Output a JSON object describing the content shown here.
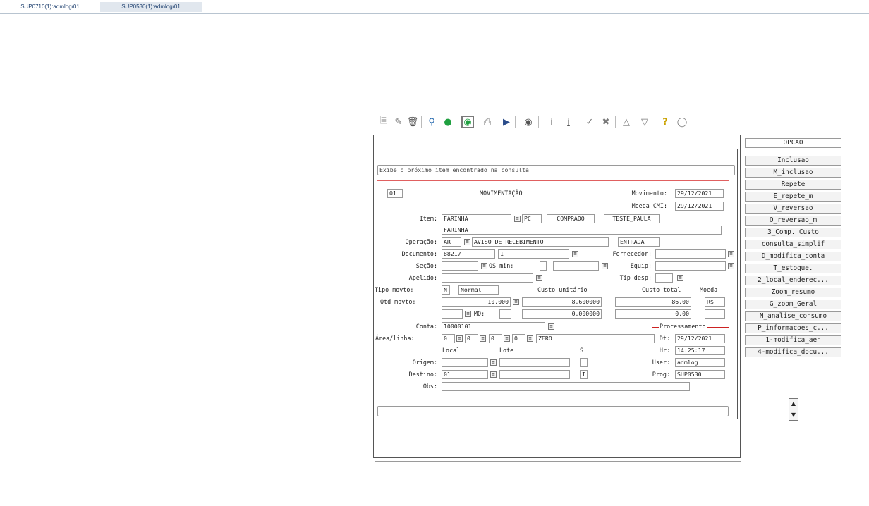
{
  "tabs": [
    "SUP0710(1):admlog/01",
    "SUP0530(1):admlog/01"
  ],
  "toolbar": {
    "icons": [
      "new-doc-icon",
      "edit-doc-icon",
      "trash-icon",
      "search-icon",
      "go-green-icon",
      "go-green-selected-icon",
      "print-icon",
      "export-icon",
      "binoculars-icon",
      "info-icon",
      "underline-info-icon",
      "check-icon",
      "scissors-icon",
      "triangle-up-icon",
      "triangle-down-icon",
      "help-icon",
      "chat-icon"
    ]
  },
  "status_message": "Exibe o próximo item encontrado na consulta",
  "form": {
    "code": "01",
    "header_title": "MOVIMENTAÇÃO",
    "movimento_label": "Movimento:",
    "movimento_value": "29/12/2021",
    "moeda_cmi_label": "Moeda CMI:",
    "moeda_cmi_value": "29/12/2021",
    "item_label": "Item:",
    "item_code": "FARINHA",
    "item_unit": "PC",
    "item_type": "COMPRADO",
    "item_user": "TESTE_PAULA",
    "item_desc": "FARINHA",
    "operacao_label": "Operação:",
    "operacao_code": "AR",
    "operacao_desc": "AVISO DE RECEBIMENTO",
    "operacao_type": "ENTRADA",
    "documento_label": "Documento:",
    "documento_value": "88217",
    "documento_seq": "1",
    "fornecedor_label": "Fornecedor:",
    "secao_label": "Seção:",
    "os_min_label": "OS min:",
    "equip_label": "Equip:",
    "apelido_label": "Apelido:",
    "tip_desp_label": "Tip desp:",
    "tipo_movto_label": "Tipo movto:",
    "tipo_movto_code": "N",
    "tipo_movto_desc": "Normal",
    "custo_unitario_label": "Custo unitário",
    "custo_total_label": "Custo total",
    "moeda_label": "Moeda",
    "qtd_movto_label": "Qtd movto:",
    "qtd_value": "10.000",
    "custo_unitario_value": "8.600000",
    "custo_total_value": "86.00",
    "moeda_value": "R$",
    "mo_label": "MO:",
    "mo_unit_value": "0.000000",
    "mo_total_value": "0.00",
    "conta_label": "Conta:",
    "conta_value": "10000101",
    "processamento_label": "Processamento",
    "area_linha_label": "Área/linha:",
    "area_1": "0",
    "area_2": "0",
    "area_3": "0",
    "area_4": "0",
    "area_desc": "ZERO",
    "dt_label": "Dt:",
    "dt_value": "29/12/2021",
    "local_label": "Local",
    "lote_label": "Lote",
    "s_label": "S",
    "hr_label": "Hr:",
    "hr_value": "14:25:17",
    "origem_label": "Origem:",
    "user_label": "User:",
    "user_value": "admlog",
    "destino_label": "Destino:",
    "destino_local": "01",
    "destino_s": "I",
    "prog_label": "Prog:",
    "prog_value": "SUP0530",
    "obs_label": "Obs:"
  },
  "options": {
    "header": "OPCAO",
    "items": [
      "Inclusao",
      "M_inclusao",
      "Repete",
      "E_repete_m",
      "V_reversao",
      "O_reversao_m",
      "3_Comp. Custo",
      "consulta_simplif",
      "D_modifica_conta",
      "T_estoque.",
      "2_local_enderec...",
      "Zoom_resumo",
      "G_zoom_Geral",
      "N_analise_consumo",
      "P_informacoes_c...",
      "1-modifica_aen",
      "4-modifica_docu..."
    ]
  },
  "colors": {
    "tab_active_bg": "#e1e7ee",
    "tab_text": "#1d3f6e",
    "status_underline": "#e06060",
    "processamento_line": "#cc2222"
  }
}
